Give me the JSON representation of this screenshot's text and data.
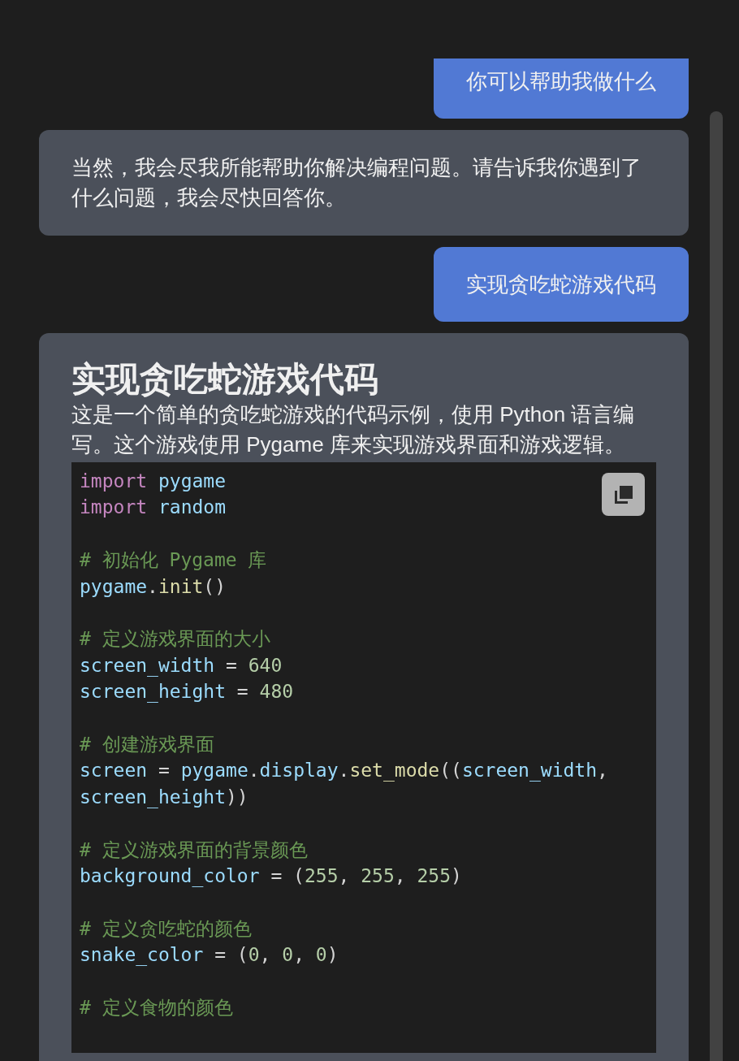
{
  "messages": [
    {
      "kind": "user",
      "text": "你可以帮助我做什么"
    },
    {
      "kind": "assistant",
      "paragraphs": [
        "当然，我会尽我所能帮助你解决编程问题。请告诉我你遇到了什么问题，我会尽快回答你。"
      ]
    },
    {
      "kind": "user",
      "text": "实现贪吃蛇游戏代码"
    },
    {
      "kind": "assistant",
      "heading": "实现贪吃蛇游戏代码",
      "paragraphs": [
        "这是一个简单的贪吃蛇游戏的代码示例，使用 Python 语言编写。这个游戏使用 Pygame 库来实现游戏界面和游戏逻辑。"
      ],
      "code": [
        {
          "kind": "code",
          "tokens": [
            {
              "kind": "keyword",
              "text": "import "
            },
            {
              "kind": "name",
              "text": "pygame"
            }
          ]
        },
        {
          "kind": "code",
          "tokens": [
            {
              "kind": "keyword",
              "text": "import "
            },
            {
              "kind": "name",
              "text": "random"
            }
          ]
        },
        {
          "kind": "blank"
        },
        {
          "kind": "code",
          "tokens": [
            {
              "kind": "comment",
              "text": "# 初始化 Pygame 库"
            }
          ]
        },
        {
          "kind": "code",
          "tokens": [
            {
              "kind": "name",
              "text": "pygame"
            },
            {
              "kind": "plain",
              "text": "."
            },
            {
              "kind": "function",
              "text": "init"
            },
            {
              "kind": "plain",
              "text": "()"
            }
          ]
        },
        {
          "kind": "blank"
        },
        {
          "kind": "code",
          "tokens": [
            {
              "kind": "comment",
              "text": "# 定义游戏界面的大小"
            }
          ]
        },
        {
          "kind": "code",
          "tokens": [
            {
              "kind": "name",
              "text": "screen_width"
            },
            {
              "kind": "plain",
              "text": " = "
            },
            {
              "kind": "number",
              "text": "640"
            }
          ]
        },
        {
          "kind": "code",
          "tokens": [
            {
              "kind": "name",
              "text": "screen_height"
            },
            {
              "kind": "plain",
              "text": " = "
            },
            {
              "kind": "number",
              "text": "480"
            }
          ]
        },
        {
          "kind": "blank"
        },
        {
          "kind": "code",
          "tokens": [
            {
              "kind": "comment",
              "text": "# 创建游戏界面"
            }
          ]
        },
        {
          "kind": "code",
          "tokens": [
            {
              "kind": "name",
              "text": "screen"
            },
            {
              "kind": "plain",
              "text": " = "
            },
            {
              "kind": "name",
              "text": "pygame"
            },
            {
              "kind": "plain",
              "text": "."
            },
            {
              "kind": "name",
              "text": "display"
            },
            {
              "kind": "plain",
              "text": "."
            },
            {
              "kind": "function",
              "text": "set_mode"
            },
            {
              "kind": "plain",
              "text": "(("
            },
            {
              "kind": "name",
              "text": "screen_width"
            },
            {
              "kind": "plain",
              "text": ", "
            },
            {
              "kind": "name",
              "text": "screen_height"
            },
            {
              "kind": "plain",
              "text": "))"
            }
          ]
        },
        {
          "kind": "blank"
        },
        {
          "kind": "code",
          "tokens": [
            {
              "kind": "comment",
              "text": "# 定义游戏界面的背景颜色"
            }
          ]
        },
        {
          "kind": "code",
          "tokens": [
            {
              "kind": "name",
              "text": "background_color"
            },
            {
              "kind": "plain",
              "text": " = ("
            },
            {
              "kind": "number",
              "text": "255"
            },
            {
              "kind": "plain",
              "text": ", "
            },
            {
              "kind": "number",
              "text": "255"
            },
            {
              "kind": "plain",
              "text": ", "
            },
            {
              "kind": "number",
              "text": "255"
            },
            {
              "kind": "plain",
              "text": ")"
            }
          ]
        },
        {
          "kind": "blank"
        },
        {
          "kind": "code",
          "tokens": [
            {
              "kind": "comment",
              "text": "# 定义贪吃蛇的颜色"
            }
          ]
        },
        {
          "kind": "code",
          "tokens": [
            {
              "kind": "name",
              "text": "snake_color"
            },
            {
              "kind": "plain",
              "text": " = ("
            },
            {
              "kind": "number",
              "text": "0"
            },
            {
              "kind": "plain",
              "text": ", "
            },
            {
              "kind": "number",
              "text": "0"
            },
            {
              "kind": "plain",
              "text": ", "
            },
            {
              "kind": "number",
              "text": "0"
            },
            {
              "kind": "plain",
              "text": ")"
            }
          ]
        },
        {
          "kind": "blank"
        },
        {
          "kind": "code",
          "tokens": [
            {
              "kind": "comment",
              "text": "# 定义食物的颜色"
            }
          ]
        }
      ]
    }
  ]
}
